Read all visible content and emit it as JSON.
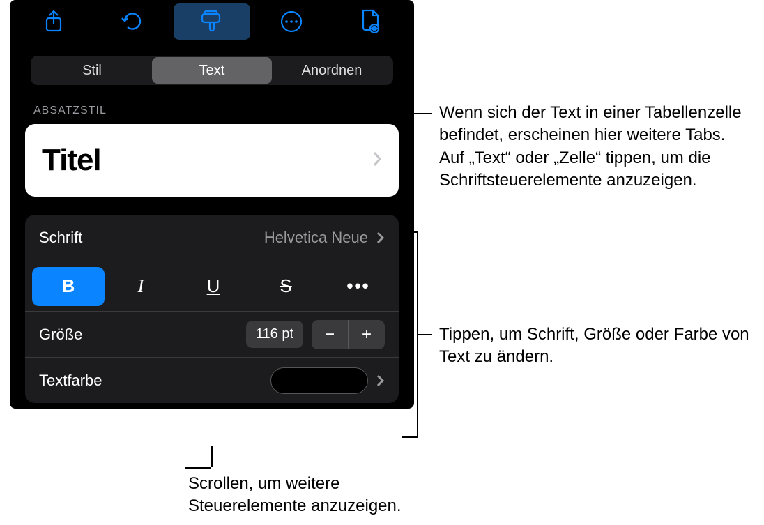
{
  "toolbar": {
    "icons": {
      "share": "share-icon",
      "undo": "undo-icon",
      "format": "format-brush-icon",
      "more": "more-icon",
      "document": "document-view-icon"
    }
  },
  "tabs": {
    "style": "Stil",
    "text": "Text",
    "arrange": "Anordnen",
    "selected": "text"
  },
  "section_label": "ABSATZSTIL",
  "paragraph_style": {
    "title": "Titel"
  },
  "font_row": {
    "label": "Schrift",
    "value": "Helvetica Neue"
  },
  "style_buttons": {
    "bold": "B",
    "italic": "I",
    "underline": "U",
    "strike": "S",
    "more": "•••"
  },
  "size_row": {
    "label": "Größe",
    "value": "116 pt",
    "minus": "−",
    "plus": "+"
  },
  "color_row": {
    "label": "Textfarbe",
    "swatch_hex": "#000000"
  },
  "callouts": {
    "tabs_note": "Wenn sich der Text in einer Tabellenzelle befindet, erscheinen hier weitere Tabs. Auf „Text“ oder „Zelle“ tippen, um die Schriftsteuerelemente anzuzeigen.",
    "card_note": "Tippen, um Schrift, Größe oder Farbe von Text zu ändern.",
    "scroll_note": "Scrollen, um weitere Steuerelemente anzuzeigen."
  }
}
